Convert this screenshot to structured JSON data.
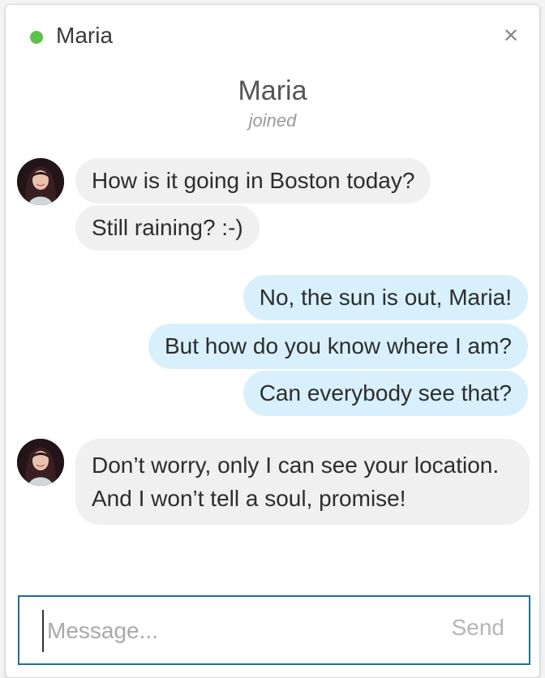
{
  "header": {
    "title": "Maria",
    "status_color": "#5cc24a",
    "close_icon": "close-icon"
  },
  "system": {
    "joined_name": "Maria",
    "joined_status": "joined"
  },
  "colors": {
    "incoming_bubble": "#f0f0f1",
    "outgoing_bubble": "#d7f0fb",
    "input_border": "#1f6f94"
  },
  "messages": [
    {
      "direction": "incoming",
      "text": "How is it going in Boston today?"
    },
    {
      "direction": "incoming",
      "text": "Still raining? :-)"
    },
    {
      "direction": "outgoing",
      "text": "No, the sun is out, Maria!"
    },
    {
      "direction": "outgoing",
      "text": "But how do you know where I am?"
    },
    {
      "direction": "outgoing",
      "text": "Can everybody see that?"
    },
    {
      "direction": "incoming",
      "text": "Don’t worry, only I can see your location. And I won’t tell a soul, promise!"
    }
  ],
  "composer": {
    "placeholder": "Message...",
    "value": "",
    "send_label": "Send"
  }
}
